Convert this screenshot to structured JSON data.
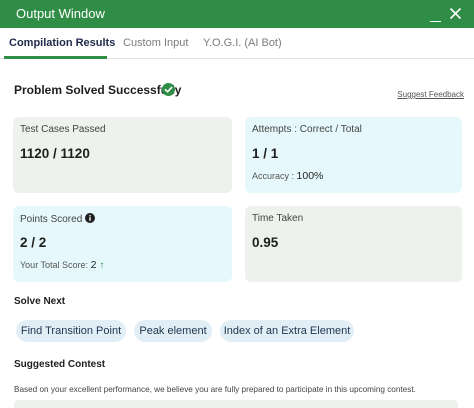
{
  "window": {
    "title": "Output Window"
  },
  "tabs": [
    {
      "label": "Compilation Results",
      "active": true
    },
    {
      "label": "Custom Input",
      "active": false
    },
    {
      "label": "Y.O.G.I. (AI Bot)",
      "active": false
    }
  ],
  "result": {
    "status": "Problem Solved Successfully",
    "feedback_link": "Suggest Feedback"
  },
  "cards": {
    "test_cases": {
      "label": "Test Cases Passed",
      "value": "1120 / 1120"
    },
    "attempts": {
      "label": "Attempts : Correct / Total",
      "value": "1 / 1",
      "sub_label": "Accuracy :",
      "sub_value": "100%"
    },
    "points": {
      "label": "Points Scored",
      "value": "2 / 2",
      "sub_label": "Your Total Score:",
      "sub_value": "2"
    },
    "time": {
      "label": "Time Taken",
      "value": "0.95"
    }
  },
  "solve_next": {
    "title": "Solve Next",
    "items": [
      "Find Transition Point",
      "Peak element",
      "Index of an Extra Element"
    ]
  },
  "contest": {
    "title": "Suggested Contest",
    "description": "Based on your excellent performance, we believe you are fully prepared to participate in this upcoming contest."
  },
  "colors": {
    "brand_green": "#2f8d46",
    "card_gray": "#edf2ed",
    "card_blue": "#e6f8fb",
    "chip_bg": "#e2eef6"
  }
}
